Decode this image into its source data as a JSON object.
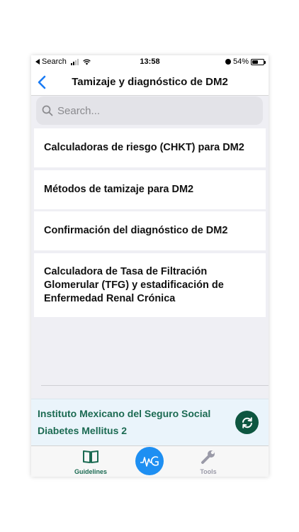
{
  "status_bar": {
    "back_app": "Search",
    "time": "13:58",
    "battery_pct": "54%",
    "battery_level": 0.54
  },
  "nav": {
    "title": "Tamizaje y diagnóstico de DM2",
    "back_icon": "chevron-left-icon"
  },
  "search": {
    "placeholder": "Search..."
  },
  "list": {
    "items": [
      {
        "label": "Calculadoras de riesgo (CHKT) para DM2"
      },
      {
        "label": "Métodos de tamizaje para DM2"
      },
      {
        "label": "Confirmación del diagnóstico de DM2"
      },
      {
        "label": "Calculadora de Tasa de Filtración Glomerular (TFG) y estadificación de Enfermedad Renal Crónica"
      }
    ]
  },
  "banner": {
    "line1": "Instituto Mexicano del Seguro Social",
    "line2": "Diabetes Mellitus 2",
    "refresh_icon": "refresh-icon"
  },
  "tab_bar": {
    "tabs": [
      {
        "label": "Guidelines",
        "icon": "book-icon",
        "color": "#1b6a52"
      },
      {
        "label": "Tools",
        "icon": "wrench-icon",
        "color": "#9a9aa8"
      }
    ],
    "center_logo": "mg-logo-icon",
    "center_color": "#1e8ff2"
  },
  "colors": {
    "accent_blue": "#1a7cf5",
    "banner_text": "#1b6a52",
    "refresh_bg": "#0e5640",
    "list_bg": "#efeff4"
  }
}
